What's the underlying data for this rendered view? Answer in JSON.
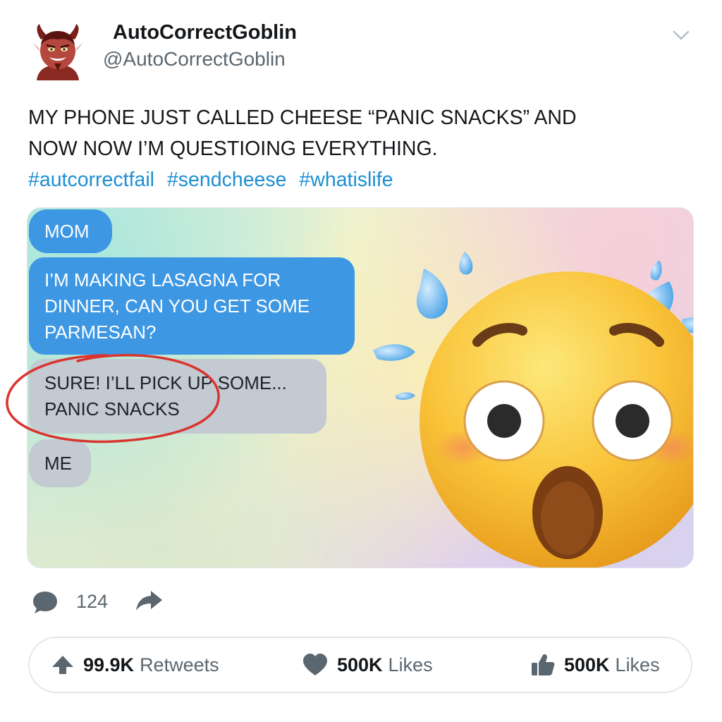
{
  "author": {
    "display_name": "AutoCorrectGoblin",
    "handle": "@AutoCorrectGoblin"
  },
  "tweet": {
    "lines": [
      "MY PHONE JUST CALLED CHEESE “PANIC SNACKS” AND",
      "NOW NOW I’M QUESTIOING EVERYTHING."
    ],
    "hashtags": [
      "#autcorrectfail",
      "#sendcheese",
      "#whatislife"
    ]
  },
  "chat": {
    "mom_label": "MOM",
    "request_lines": [
      "I’M MAKING LASAGNA FOR",
      "DINNER, CAN YOU GET SOME",
      "PARMESAN?"
    ],
    "reply_lines": [
      "SURE! I’LL PICK UP SOME...",
      "PANIC SNACKS"
    ],
    "me_label": "ME"
  },
  "actions": {
    "reply_count": "124"
  },
  "stats": {
    "retweets": {
      "count": "99.9K",
      "label": "Retweets"
    },
    "likes_heart": {
      "count": "500K",
      "label": "Likes"
    },
    "likes_thumb": {
      "count": "500K",
      "label": "Likes"
    }
  },
  "icons": {
    "avatar": "devil-avatar-icon",
    "chevron": "chevron-down-icon",
    "emoji": "astonished-face-sweat-icon",
    "reply": "speech-bubble-icon",
    "share": "share-arrow-icon",
    "retweet": "arrow-up-icon",
    "heart": "heart-icon",
    "thumb": "thumbs-up-icon"
  },
  "colors": {
    "hashtag": "#1d8fd3",
    "mom_bubble": "#3d97e3",
    "me_bubble": "#c3cad2",
    "highlight_circle": "#d9342f",
    "icon_gray": "#5b6770"
  }
}
